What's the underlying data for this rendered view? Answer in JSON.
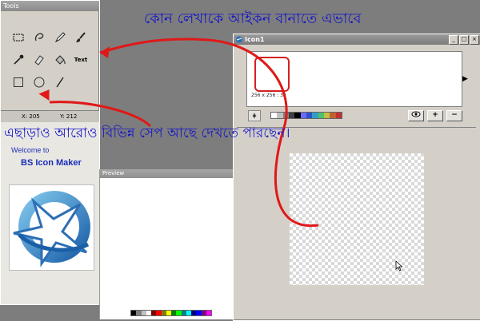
{
  "tools_panel": {
    "title": "Tools",
    "tools": [
      {
        "name": "rect-select-icon"
      },
      {
        "name": "lasso-icon"
      },
      {
        "name": "pencil-icon"
      },
      {
        "name": "brush-icon"
      },
      {
        "name": "dropper-icon"
      },
      {
        "name": "eraser-icon"
      },
      {
        "name": "fill-bucket-icon"
      },
      {
        "name": "text-tool",
        "label": "Text"
      },
      {
        "name": "rectangle-icon"
      },
      {
        "name": "ellipse-icon"
      },
      {
        "name": "line-icon"
      }
    ],
    "coords": {
      "x": "X: 205",
      "y": "Y: 212"
    },
    "welcome": "Welcome to",
    "app_name": "BS Icon Maker"
  },
  "preview": {
    "title": "Preview",
    "palette": [
      "#000000",
      "#808080",
      "#c0c0c0",
      "#ffffff",
      "#800000",
      "#ff0000",
      "#808000",
      "#ffff00",
      "#008000",
      "#00ff00",
      "#008080",
      "#00ffff",
      "#000080",
      "#0000ff",
      "#800080",
      "#ff00ff"
    ]
  },
  "icon_window": {
    "title": "Icon1",
    "buttons": {
      "minimize": "_",
      "maximize": "□",
      "close": "×"
    },
    "thumbnail_caption": "256 x 256 : 32",
    "toolbar": {
      "grid": "⋕",
      "view": "👁",
      "add": "+",
      "remove": "−"
    },
    "colors": [
      "#ffffff",
      "#c0c0c0",
      "#808080",
      "#404040",
      "#000000",
      "#6a6aff",
      "#3050c8",
      "#30a0c0",
      "#50c070",
      "#c0c040",
      "#c06030",
      "#c03030"
    ]
  },
  "annotations": {
    "top": "কোন লেখাকে আইকন বানাতে এভাবে",
    "middle": "এছাড়াও আরোও বিভিন্ন সেপ আছে দেখতে পারছেন।"
  },
  "colors": {
    "arrow": "#e01818",
    "annotation_text": "#1616c8",
    "accent": "#1a30b8"
  }
}
